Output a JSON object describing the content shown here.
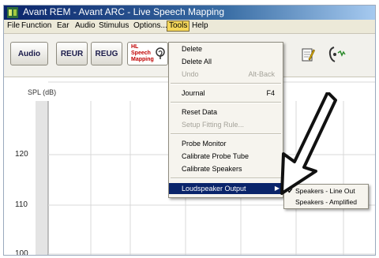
{
  "window": {
    "title": "Avant REM - Avant ARC - Live Speech Mapping"
  },
  "menubar": {
    "items": [
      "File",
      "Function",
      "Ear",
      "Audio",
      "Stimulus",
      "Options...",
      "Tools",
      "Help"
    ],
    "active": "Tools"
  },
  "toolbar": {
    "audio_label": "Audio",
    "reur_label": "REUR",
    "reug_label": "REUG",
    "speech_mapping_label": "HL\nSpeech\nMapping"
  },
  "chart": {
    "y_axis_label": "SPL (dB)",
    "y_ticks": [
      "120",
      "110",
      "100"
    ]
  },
  "tools_menu": {
    "items": [
      {
        "label": "Delete",
        "shortcut": "",
        "enabled": true
      },
      {
        "label": "Delete All",
        "shortcut": "",
        "enabled": true
      },
      {
        "label": "Undo",
        "shortcut": "Alt-Back",
        "enabled": false
      },
      {
        "label": "Journal",
        "shortcut": "F4",
        "enabled": true
      },
      {
        "label": "Reset Data",
        "shortcut": "",
        "enabled": true
      },
      {
        "label": "Setup Fitting Rule...",
        "shortcut": "",
        "enabled": false
      },
      {
        "label": "Probe Monitor",
        "shortcut": "",
        "enabled": true
      },
      {
        "label": "Calibrate Probe Tube",
        "shortcut": "",
        "enabled": true
      },
      {
        "label": "Calibrate Speakers",
        "shortcut": "",
        "enabled": true
      },
      {
        "label": "Loudspeaker Output",
        "shortcut": "",
        "enabled": true
      }
    ],
    "highlighted": "Loudspeaker Output"
  },
  "loudspeaker_submenu": {
    "items": [
      {
        "label": "Speakers - Line Out",
        "checked": true
      },
      {
        "label": "Speakers - Amplified",
        "checked": false
      }
    ]
  },
  "colors": {
    "titlebar_start": "#0a246a",
    "menu_highlight": "#0a246a",
    "active_menu": "#f5d75a",
    "speech_mapping_text": "#c00000"
  }
}
